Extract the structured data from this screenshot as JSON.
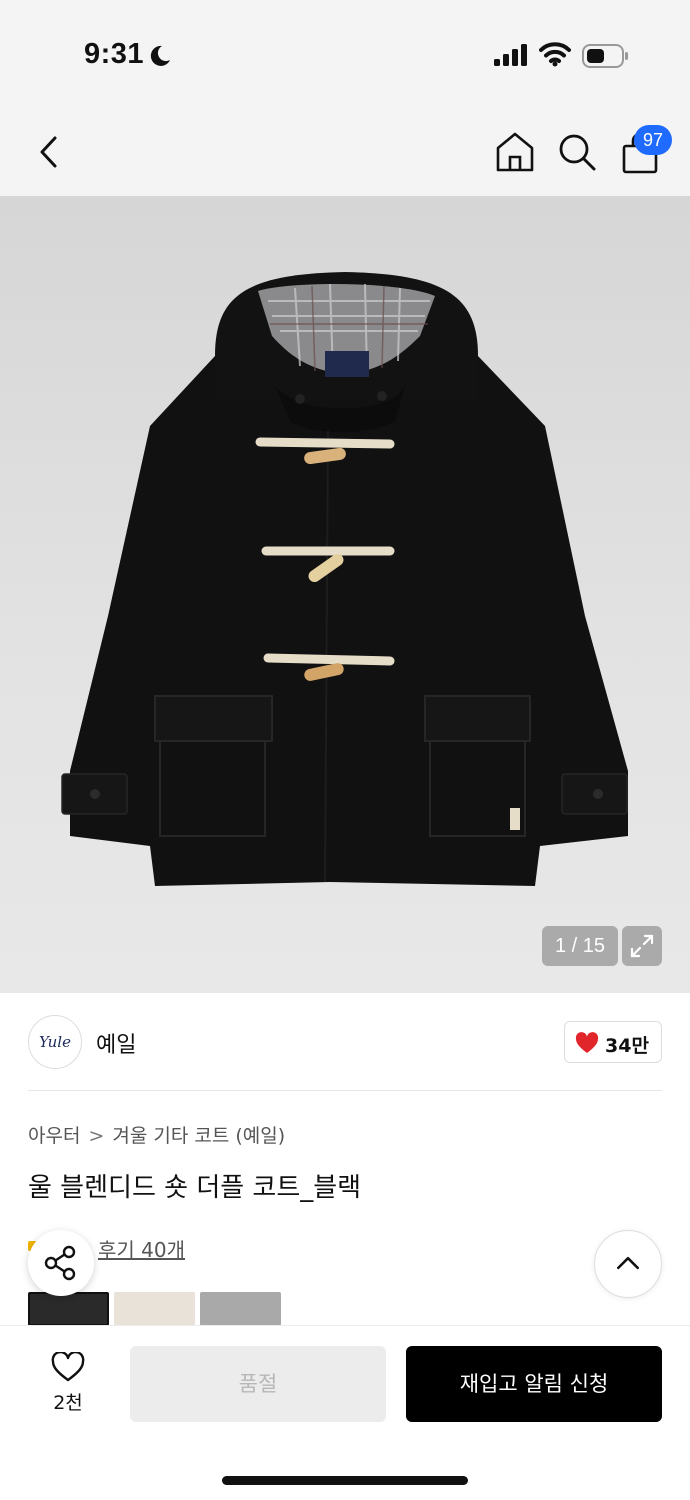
{
  "status_bar": {
    "time": "9:31"
  },
  "nav": {
    "cart_count": "97"
  },
  "gallery": {
    "counter": "1 / 15"
  },
  "brand": {
    "logo_text": "Yule",
    "name": "예일",
    "like_count": "34만"
  },
  "product": {
    "breadcrumb_category": "아우터",
    "breadcrumb_chevron": ">",
    "breadcrumb_subcategory": "겨울 기타 코트 (예일)",
    "title": "울 블렌디드 숏 더플 코트_블랙",
    "review_link": "후기 40개",
    "swatches": [
      "black",
      "beige",
      "brown"
    ]
  },
  "bottom_bar": {
    "wish_count": "2천",
    "soldout_label": "품절",
    "restock_label": "재입고 알림 신청"
  },
  "colors": {
    "accent_badge": "#1f6bff",
    "heart": "#e0262b",
    "primary_button": "#000000",
    "disabled_button": "#ececec"
  }
}
